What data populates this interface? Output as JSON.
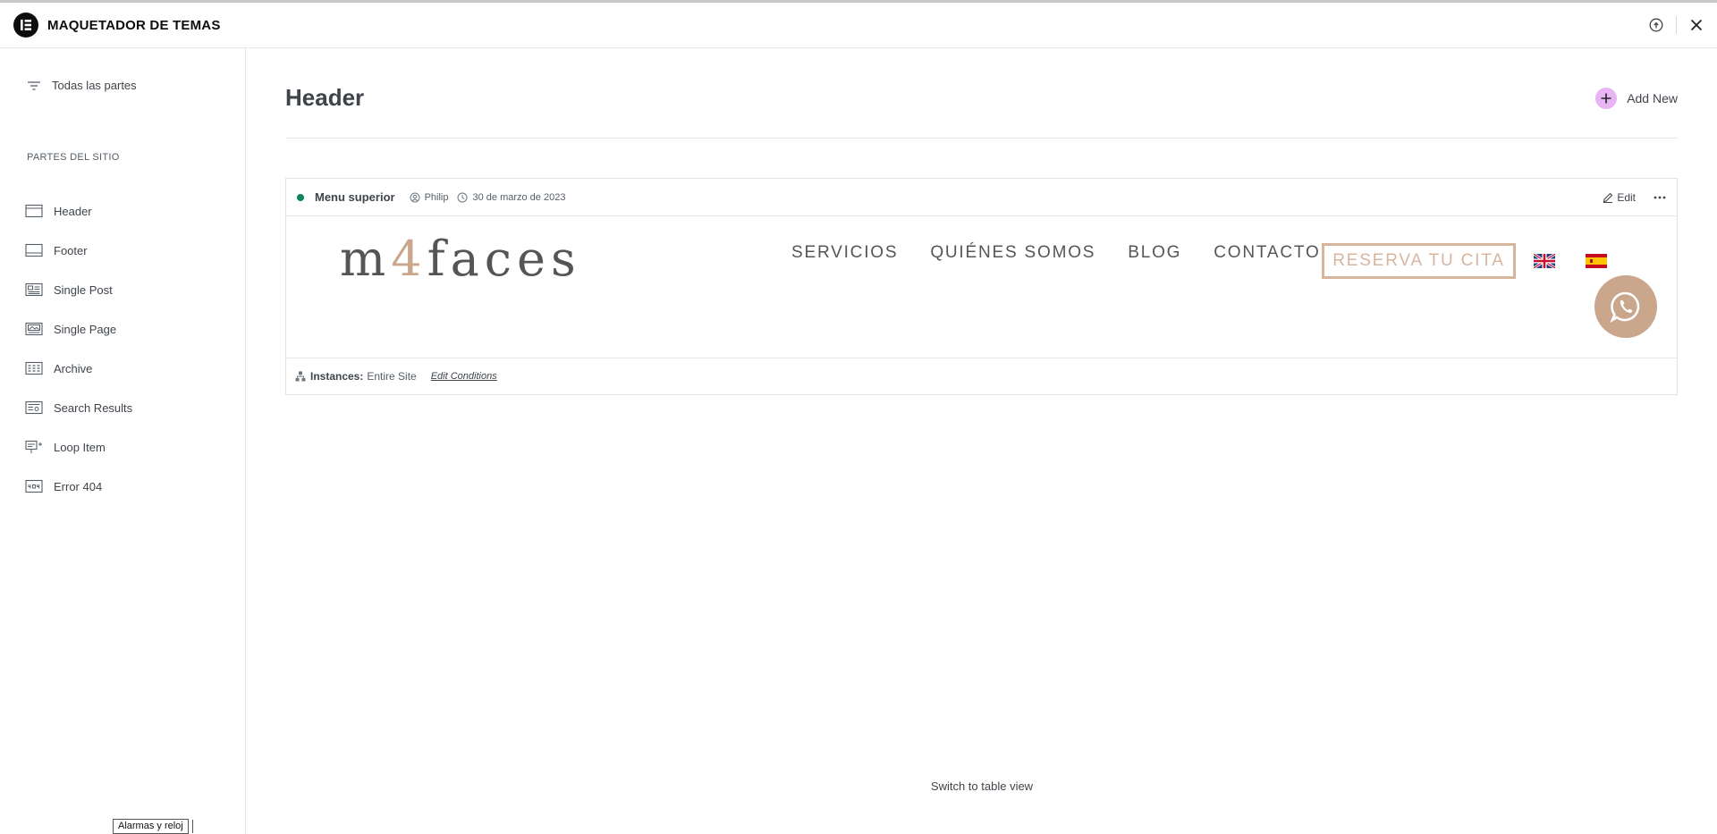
{
  "app": {
    "title": "MAQUETADOR DE TEMAS"
  },
  "sidebar": {
    "all_parts_label": "Todas las partes",
    "section_title": "PARTES DEL SITIO",
    "items": [
      {
        "label": "Header",
        "icon": "header-icon"
      },
      {
        "label": "Footer",
        "icon": "footer-icon"
      },
      {
        "label": "Single Post",
        "icon": "single-post-icon"
      },
      {
        "label": "Single Page",
        "icon": "single-page-icon"
      },
      {
        "label": "Archive",
        "icon": "archive-icon"
      },
      {
        "label": "Search Results",
        "icon": "search-results-icon"
      },
      {
        "label": "Loop Item",
        "icon": "loop-item-icon"
      },
      {
        "label": "Error 404",
        "icon": "error-404-icon"
      }
    ]
  },
  "main": {
    "title": "Header",
    "add_new_label": "Add New",
    "switch_view_label": "Switch to table view"
  },
  "card": {
    "name": "Menu superior",
    "author": "Philip",
    "date": "30 de marzo de 2023",
    "status_color": "#0a875a",
    "edit_label": "Edit",
    "instances_label": "Instances:",
    "instances_value": "Entire Site",
    "edit_conditions_label": "Edit Conditions"
  },
  "preview": {
    "brand_pre": "m",
    "brand_accent": "4",
    "brand_post": "faces",
    "nav": [
      "SERVICIOS",
      "QUIÉNES SOMOS",
      "BLOG",
      "CONTACTO"
    ],
    "cta_label": "RESERVA TU CITA",
    "accent_color": "#c9a68c"
  },
  "tooltip": {
    "text": "Alarmas y reloj"
  }
}
